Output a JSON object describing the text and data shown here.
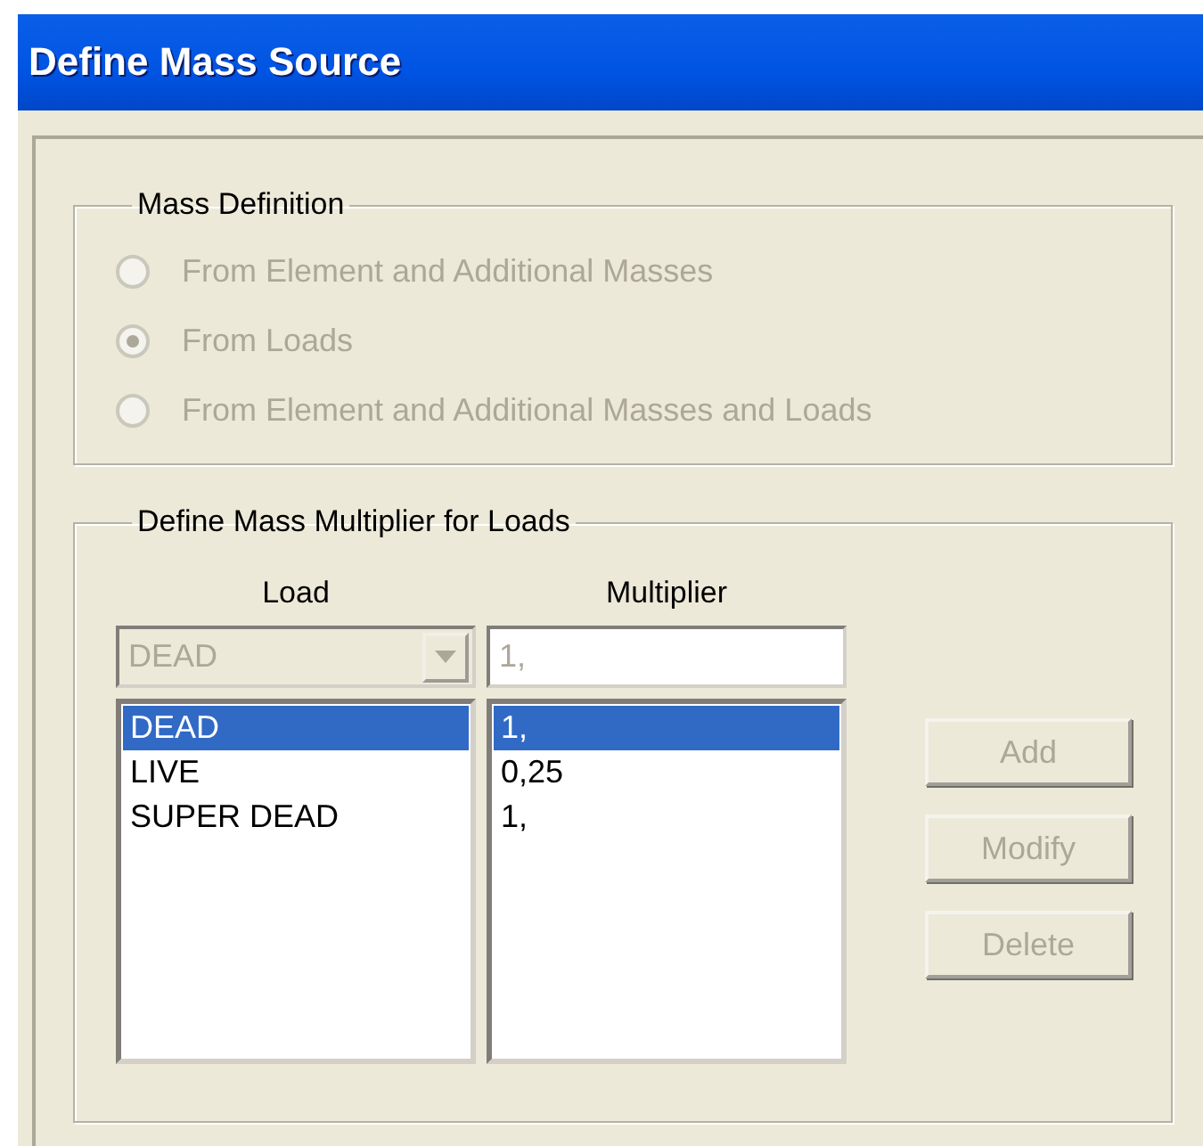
{
  "window": {
    "title": "Define Mass Source"
  },
  "mass_definition": {
    "title": "Mass Definition",
    "options": [
      {
        "label": "From Element and Additional Masses",
        "selected": false,
        "disabled": true
      },
      {
        "label": "From Loads",
        "selected": true,
        "disabled": true
      },
      {
        "label": "From Element and Additional Masses and Loads",
        "selected": false,
        "disabled": true
      }
    ]
  },
  "multiplier_group": {
    "title": "Define Mass Multiplier for Loads",
    "columns": [
      "Load",
      "Multiplier"
    ],
    "load_select": {
      "value": "DEAD",
      "disabled": true
    },
    "multiplier_field": {
      "value": "1,",
      "disabled": true
    },
    "rows": [
      {
        "load": "DEAD",
        "multiplier": "1,",
        "selected": true
      },
      {
        "load": "LIVE",
        "multiplier": "0,25",
        "selected": false
      },
      {
        "load": "SUPER DEAD",
        "multiplier": "1,",
        "selected": false
      }
    ],
    "buttons": [
      {
        "label": "Add",
        "disabled": true
      },
      {
        "label": "Modify",
        "disabled": true
      },
      {
        "label": "Delete",
        "disabled": true
      }
    ]
  }
}
